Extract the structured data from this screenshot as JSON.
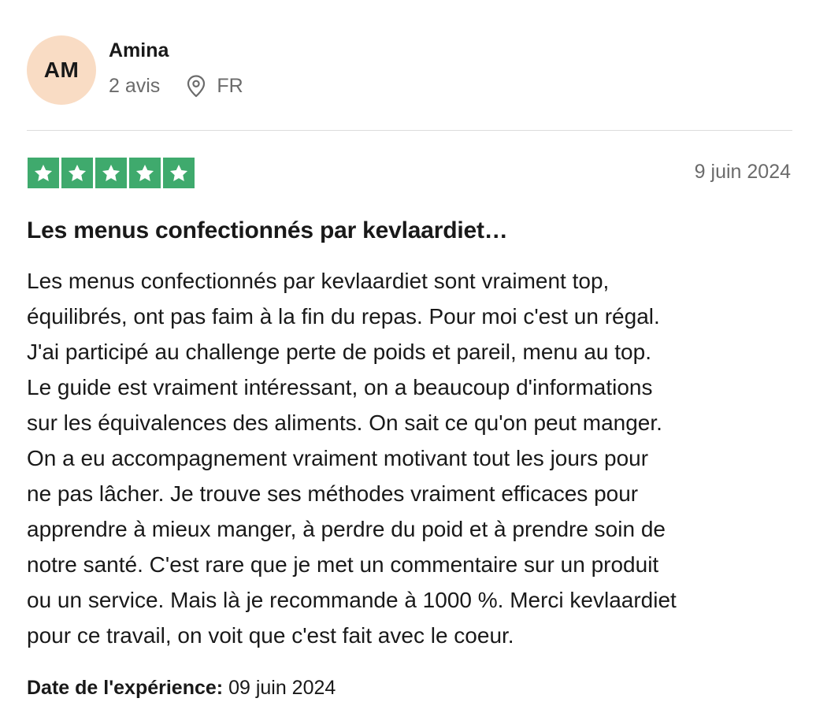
{
  "reviewer": {
    "initials": "AM",
    "name": "Amina",
    "review_count": "2 avis",
    "country": "FR",
    "avatar_color": "#f9dcc4"
  },
  "rating": {
    "stars": 5,
    "max_stars": 5,
    "star_color": "#3faa6d"
  },
  "review": {
    "date": "9 juin 2024",
    "title": "Les menus confectionnés par kevlaardiet…",
    "body_lines": [
      "Les menus confectionnés par kevlaardiet sont vraiment top,",
      "équilibrés, ont pas faim à la fin du repas. Pour moi c'est un régal.",
      "J'ai participé au challenge perte de poids et pareil, menu au top.",
      "Le guide est vraiment intéressant, on a beaucoup d'informations",
      "sur les équivalences des aliments. On sait ce qu'on peut manger.",
      "On a eu accompagnement vraiment motivant tout les jours pour",
      "ne pas lâcher. Je trouve ses méthodes vraiment efficaces pour",
      "apprendre à mieux manger, à perdre du poid et à prendre soin de",
      "notre santé. C'est rare que je met un commentaire sur un produit",
      "ou un service. Mais là je recommande à 1000 %. Merci kevlaardiet",
      "pour ce travail, on voit que c'est fait avec le coeur."
    ],
    "experience_label": "Date de l'expérience:",
    "experience_date": "09 juin 2024"
  },
  "icons": {
    "location": "map-pin-icon",
    "star": "star-icon"
  }
}
